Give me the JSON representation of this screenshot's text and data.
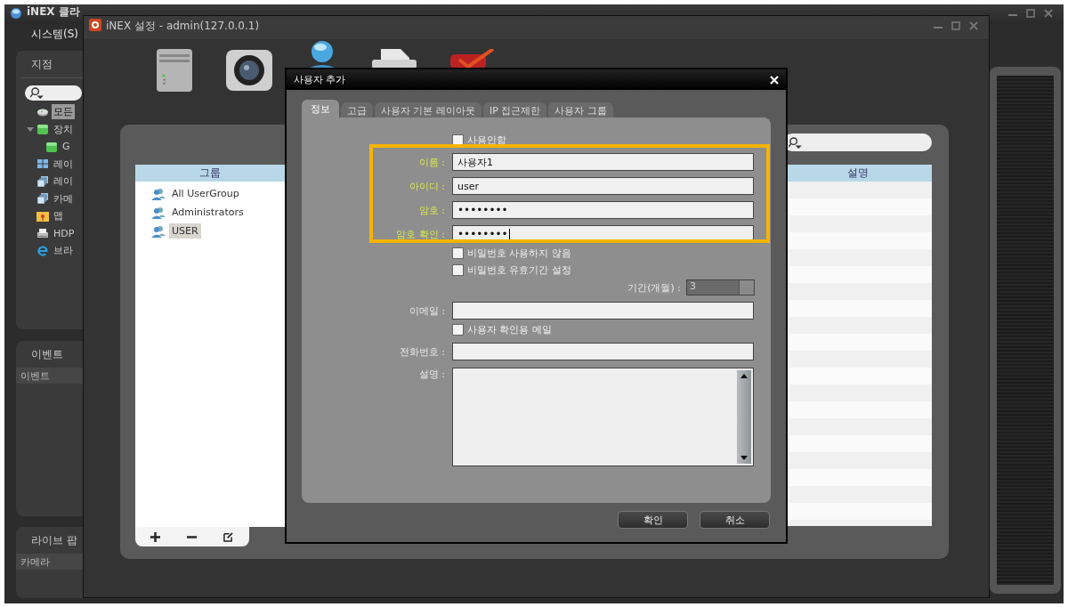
{
  "main_window": {
    "title": "iNEX 클라",
    "menu": [
      "시스템(S)"
    ]
  },
  "site_panel": {
    "title": "지점",
    "tree": [
      {
        "kind": "all",
        "label": "모든",
        "selected": true
      },
      {
        "kind": "device",
        "label": "장치",
        "selected": false,
        "expanded": true,
        "children": [
          {
            "kind": "group",
            "label": "G",
            "selected": false
          }
        ]
      },
      {
        "kind": "layout",
        "label": "레이",
        "selected": false
      },
      {
        "kind": "layout-set",
        "label": "레이",
        "selected": false
      },
      {
        "kind": "camera",
        "label": "카메",
        "selected": false
      },
      {
        "kind": "map",
        "label": "맵",
        "selected": false
      },
      {
        "kind": "hdp",
        "label": "HDP",
        "selected": false
      },
      {
        "kind": "browser",
        "label": "브라",
        "selected": false
      }
    ]
  },
  "event_panel": {
    "title": "이벤트",
    "columns": [
      "이벤트"
    ]
  },
  "live_popup_panel": {
    "title": "라이브 팝",
    "columns": [
      "카메라"
    ]
  },
  "settings_window": {
    "title": "iNEX 설정 - admin(127.0.0.1)",
    "group_list": {
      "header": "그룹",
      "items": [
        {
          "label": "All UserGroup",
          "selected": false
        },
        {
          "label": "Administrators",
          "selected": false
        },
        {
          "label": "USER",
          "selected": true
        }
      ]
    },
    "table": {
      "columns": [
        "설명"
      ]
    }
  },
  "dialog": {
    "title": "사용자 추가",
    "tabs": [
      {
        "label": "정보",
        "selected": true
      },
      {
        "label": "고급",
        "selected": false
      },
      {
        "label": "사용자 기본 레이아웃",
        "selected": false
      },
      {
        "label": "IP 접근제한",
        "selected": false
      },
      {
        "label": "사용자 그룹",
        "selected": false
      }
    ],
    "form": [
      {
        "kind": "checkbox",
        "label": "사용안함",
        "checked": false
      },
      {
        "kind": "text",
        "label": "이름 :",
        "value": "사용자1",
        "highlighted": true,
        "focused": false
      },
      {
        "kind": "text",
        "label": "아이디 :",
        "value": "user",
        "highlighted": true,
        "focused": false
      },
      {
        "kind": "password",
        "label": "암호 :",
        "value": "••••••••",
        "highlighted": true,
        "focused": false
      },
      {
        "kind": "password",
        "label": "암호 확인 :",
        "value": "••••••••",
        "highlighted": true,
        "focused": true
      },
      {
        "kind": "checkbox",
        "label": "비밀번호 사용하지 않음",
        "checked": false
      },
      {
        "kind": "checkbox",
        "label": "비밀번호 유효기간 설정",
        "checked": false
      },
      {
        "kind": "spinner",
        "label": "기간(개월) :",
        "value": "3",
        "disabled": true
      },
      {
        "kind": "text",
        "label": "이메일 :",
        "highlighted": false,
        "focused": false
      },
      {
        "kind": "checkbox",
        "label": "사용자 확인용 메일",
        "checked": false
      },
      {
        "kind": "text",
        "label": "전화번호 :",
        "highlighted": false,
        "focused": false
      },
      {
        "kind": "textarea",
        "label": "설명 :"
      }
    ],
    "buttons": [
      "확인",
      "취소"
    ]
  }
}
